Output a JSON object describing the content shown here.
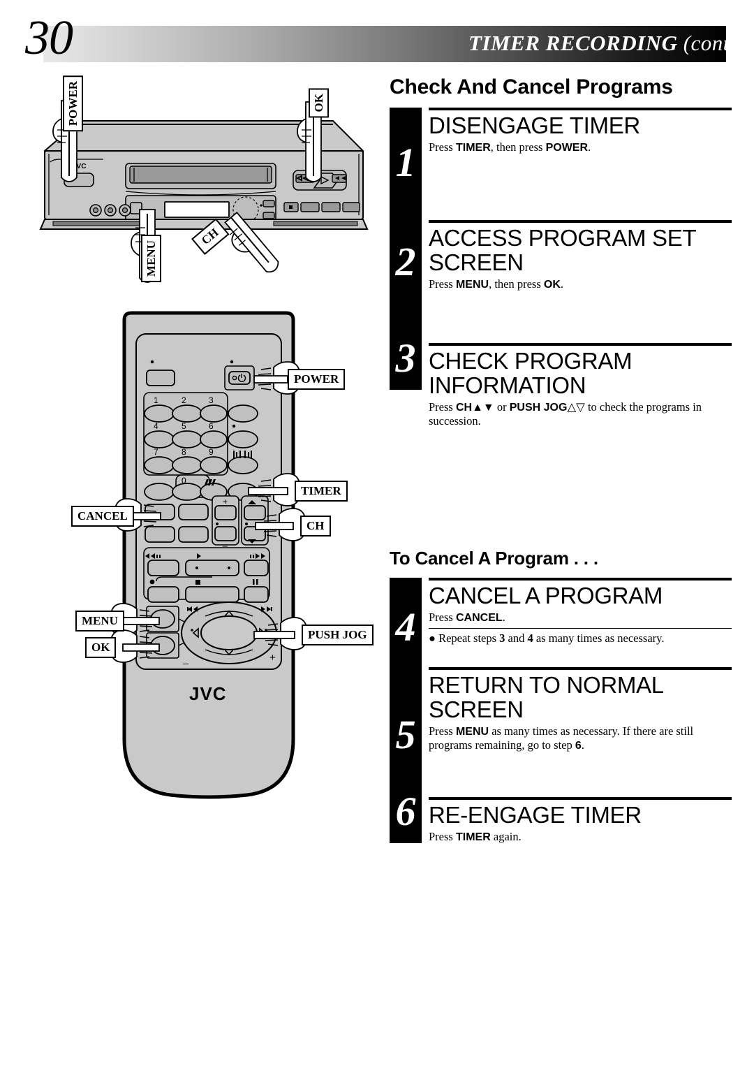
{
  "header": {
    "page_number": "30",
    "title_main": "TIMER RECORDING",
    "title_cont": "(cont.)"
  },
  "section": {
    "title": "Check And Cancel Programs",
    "subtitle": "To Cancel A Program . . ."
  },
  "steps": [
    {
      "number": "1",
      "heading": "DISENGAGE TIMER",
      "body_html": "Press <b>TIMER</b>, then press <b>POWER</b>."
    },
    {
      "number": "2",
      "heading": "ACCESS PROGRAM SET\nSCREEN",
      "body_html": "Press <b>MENU</b>, then press <b>OK</b>."
    },
    {
      "number": "3",
      "heading": "CHECK PROGRAM\nINFORMATION",
      "body_html": "Press <b>CH▲▼</b> or <b>PUSH JOG</b>△▽ to check the programs in succession."
    },
    {
      "number": "4",
      "heading": "CANCEL A PROGRAM",
      "body_html": "Press <b>CANCEL</b>.",
      "note_html": "● Repeat steps <b>3</b> and <b>4</b> as many times as necessary."
    },
    {
      "number": "5",
      "heading": "RETURN TO NORMAL\nSCREEN",
      "body_html": "Press <b>MENU</b> as many times as necessary. If there are still programs remaining, go to step <b>6</b>."
    },
    {
      "number": "6",
      "heading": "RE-ENGAGE TIMER",
      "body_html": "Press <b>TIMER</b> again."
    }
  ],
  "vcr_illustration": {
    "callouts": [
      {
        "label": "POWER",
        "orientation": "vertical"
      },
      {
        "label": "OK",
        "orientation": "vertical"
      },
      {
        "label": "MENU",
        "orientation": "vertical"
      },
      {
        "label": "CH",
        "orientation": "rotated"
      }
    ],
    "brand": "JVC"
  },
  "remote_illustration": {
    "brand": "JVC",
    "keypad": [
      "1",
      "2",
      "3",
      "4",
      "5",
      "6",
      "7",
      "8",
      "9",
      "0"
    ],
    "callouts": [
      {
        "label": "POWER",
        "side": "right"
      },
      {
        "label": "TIMER",
        "side": "right"
      },
      {
        "label": "CH",
        "side": "right"
      },
      {
        "label": "PUSH JOG",
        "side": "right"
      },
      {
        "label": "CANCEL",
        "side": "left"
      },
      {
        "label": "MENU",
        "side": "left"
      },
      {
        "label": "OK",
        "side": "left"
      }
    ],
    "jog_marks": {
      "plus": "+",
      "minus": "-"
    },
    "transport_marks": {
      "rew": "◀◀",
      "play": "▶",
      "ff": "▶▶",
      "rec": "●",
      "stop": "■",
      "pause": "‖"
    }
  },
  "colors": {
    "ink": "#000000",
    "paper": "#ffffff",
    "device_body": "#c9c9c9",
    "device_panel": "#b8b8b8",
    "header_gradient_start": "#e8e8e8",
    "header_gradient_end": "#000000"
  }
}
